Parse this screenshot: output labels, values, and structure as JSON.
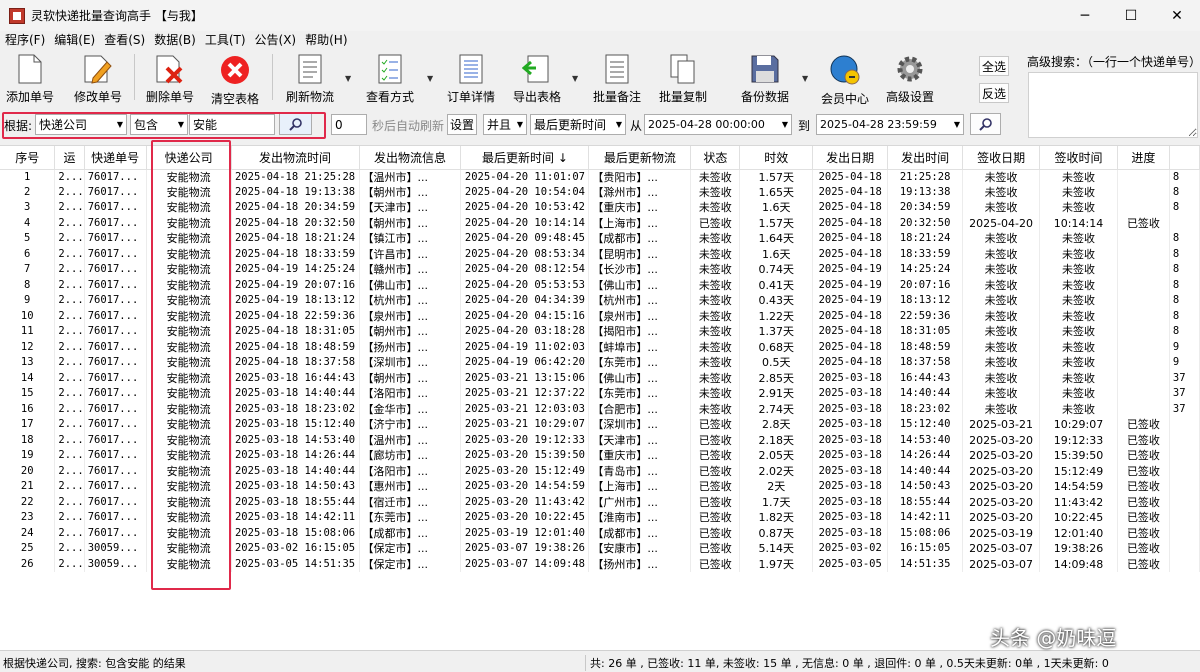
{
  "window": {
    "title": "灵软快递批量查询高手 【与我】",
    "min": "─",
    "max": "☐",
    "close": "✕"
  },
  "menu": [
    "程序(F)",
    "编辑(E)",
    "查看(S)",
    "数据(B)",
    "工具(T)",
    "公告(X)",
    "帮助(H)"
  ],
  "toolbar": {
    "add": "添加单号",
    "edit": "修改单号",
    "delete": "删除单号",
    "clear": "清空表格",
    "refresh": "刷新物流",
    "view": "查看方式",
    "detail": "订单详情",
    "export": "导出表格",
    "note": "批量备注",
    "copy": "批量复制",
    "backup": "备份数据",
    "vip": "会员中心",
    "settings": "高级设置",
    "select_all": "全选",
    "invert": "反选",
    "advanced_search_label": "高级搜索：（一行一个快递单号）"
  },
  "filter": {
    "by_label": "根据:",
    "by_value": "快递公司",
    "op_value": "包含",
    "keyword": "安能",
    "seconds": "0",
    "auto_refresh": "秒后自动刷新",
    "set_btn": "设置",
    "logic": "并且",
    "time_field": "最后更新时间",
    "from_label": "从",
    "from": "2025-04-28 00:00:00",
    "to_label": "到",
    "to": "2025-04-28 23:59:59"
  },
  "columns": [
    "序号",
    "运",
    "快递单号",
    "快递公司",
    "发出物流时间",
    "发出物流信息",
    "最后更新时间 ↓",
    "最后更新物流",
    "状态",
    "时效",
    "发出日期",
    "发出时间",
    "签收日期",
    "签收时间",
    "进度",
    ""
  ],
  "rows": [
    [
      "1",
      "2...",
      "76017...",
      "安能物流",
      "2025-04-18 21:25:28",
      "【温州市】...",
      "2025-04-20 11:01:07",
      "【贵阳市】...",
      "未签收",
      "1.57天",
      "2025-04-18",
      "21:25:28",
      "未签收",
      "未签收",
      "",
      "8"
    ],
    [
      "2",
      "2...",
      "76017...",
      "安能物流",
      "2025-04-18 19:13:38",
      "【朝州市】...",
      "2025-04-20 10:54:04",
      "【滁州市】...",
      "未签收",
      "1.65天",
      "2025-04-18",
      "19:13:38",
      "未签收",
      "未签收",
      "",
      "8"
    ],
    [
      "3",
      "2...",
      "76017...",
      "安能物流",
      "2025-04-18 20:34:59",
      "【天津市】...",
      "2025-04-20 10:53:42",
      "【重庆市】...",
      "未签收",
      "1.6天",
      "2025-04-18",
      "20:34:59",
      "未签收",
      "未签收",
      "",
      "8"
    ],
    [
      "4",
      "2...",
      "76017...",
      "安能物流",
      "2025-04-18 20:32:50",
      "【朝州市】...",
      "2025-04-20 10:14:14",
      "【上海市】...",
      "已签收",
      "1.57天",
      "2025-04-18",
      "20:32:50",
      "2025-04-20",
      "10:14:14",
      "已签收",
      ""
    ],
    [
      "5",
      "2...",
      "76017...",
      "安能物流",
      "2025-04-18 18:21:24",
      "【镇江市】...",
      "2025-04-20 09:48:45",
      "【成都市】...",
      "未签收",
      "1.64天",
      "2025-04-18",
      "18:21:24",
      "未签收",
      "未签收",
      "",
      "8"
    ],
    [
      "6",
      "2...",
      "76017...",
      "安能物流",
      "2025-04-18 18:33:59",
      "【许昌市】...",
      "2025-04-20 08:53:34",
      "【昆明市】...",
      "未签收",
      "1.6天",
      "2025-04-18",
      "18:33:59",
      "未签收",
      "未签收",
      "",
      "8"
    ],
    [
      "7",
      "2...",
      "76017...",
      "安能物流",
      "2025-04-19 14:25:24",
      "【赣州市】...",
      "2025-04-20 08:12:54",
      "【长沙市】...",
      "未签收",
      "0.74天",
      "2025-04-19",
      "14:25:24",
      "未签收",
      "未签收",
      "",
      "8"
    ],
    [
      "8",
      "2...",
      "76017...",
      "安能物流",
      "2025-04-19 20:07:16",
      "【佛山市】...",
      "2025-04-20 05:53:53",
      "【佛山市】...",
      "未签收",
      "0.41天",
      "2025-04-19",
      "20:07:16",
      "未签收",
      "未签收",
      "",
      "8"
    ],
    [
      "9",
      "2...",
      "76017...",
      "安能物流",
      "2025-04-19 18:13:12",
      "【杭州市】...",
      "2025-04-20 04:34:39",
      "【杭州市】...",
      "未签收",
      "0.43天",
      "2025-04-19",
      "18:13:12",
      "未签收",
      "未签收",
      "",
      "8"
    ],
    [
      "10",
      "2...",
      "76017...",
      "安能物流",
      "2025-04-18 22:59:36",
      "【泉州市】...",
      "2025-04-20 04:15:16",
      "【泉州市】...",
      "未签收",
      "1.22天",
      "2025-04-18",
      "22:59:36",
      "未签收",
      "未签收",
      "",
      "8"
    ],
    [
      "11",
      "2...",
      "76017...",
      "安能物流",
      "2025-04-18 18:31:05",
      "【朝州市】...",
      "2025-04-20 03:18:28",
      "【揭阳市】...",
      "未签收",
      "1.37天",
      "2025-04-18",
      "18:31:05",
      "未签收",
      "未签收",
      "",
      "8"
    ],
    [
      "12",
      "2...",
      "76017...",
      "安能物流",
      "2025-04-18 18:48:59",
      "【扬州市】...",
      "2025-04-19 11:02:03",
      "【蚌埠市】...",
      "未签收",
      "0.68天",
      "2025-04-18",
      "18:48:59",
      "未签收",
      "未签收",
      "",
      "9"
    ],
    [
      "13",
      "2...",
      "76017...",
      "安能物流",
      "2025-04-18 18:37:58",
      "【深圳市】...",
      "2025-04-19 06:42:20",
      "【东莞市】...",
      "未签收",
      "0.5天",
      "2025-04-18",
      "18:37:58",
      "未签收",
      "未签收",
      "",
      "9"
    ],
    [
      "14",
      "2...",
      "76017...",
      "安能物流",
      "2025-03-18 16:44:43",
      "【朝州市】...",
      "2025-03-21 13:15:06",
      "【佛山市】...",
      "未签收",
      "2.85天",
      "2025-03-18",
      "16:44:43",
      "未签收",
      "未签收",
      "",
      "37"
    ],
    [
      "15",
      "2...",
      "76017...",
      "安能物流",
      "2025-03-18 14:40:44",
      "【洛阳市】...",
      "2025-03-21 12:37:22",
      "【东莞市】...",
      "未签收",
      "2.91天",
      "2025-03-18",
      "14:40:44",
      "未签收",
      "未签收",
      "",
      "37"
    ],
    [
      "16",
      "2...",
      "76017...",
      "安能物流",
      "2025-03-18 18:23:02",
      "【金华市】...",
      "2025-03-21 12:03:03",
      "【合肥市】...",
      "未签收",
      "2.74天",
      "2025-03-18",
      "18:23:02",
      "未签收",
      "未签收",
      "",
      "37"
    ],
    [
      "17",
      "2...",
      "76017...",
      "安能物流",
      "2025-03-18 15:12:40",
      "【济宁市】...",
      "2025-03-21 10:29:07",
      "【深圳市】...",
      "已签收",
      "2.8天",
      "2025-03-18",
      "15:12:40",
      "2025-03-21",
      "10:29:07",
      "已签收",
      ""
    ],
    [
      "18",
      "2...",
      "76017...",
      "安能物流",
      "2025-03-18 14:53:40",
      "【温州市】...",
      "2025-03-20 19:12:33",
      "【天津市】...",
      "已签收",
      "2.18天",
      "2025-03-18",
      "14:53:40",
      "2025-03-20",
      "19:12:33",
      "已签收",
      ""
    ],
    [
      "19",
      "2...",
      "76017...",
      "安能物流",
      "2025-03-18 14:26:44",
      "【廊坊市】...",
      "2025-03-20 15:39:50",
      "【重庆市】...",
      "已签收",
      "2.05天",
      "2025-03-18",
      "14:26:44",
      "2025-03-20",
      "15:39:50",
      "已签收",
      ""
    ],
    [
      "20",
      "2...",
      "76017...",
      "安能物流",
      "2025-03-18 14:40:44",
      "【洛阳市】...",
      "2025-03-20 15:12:49",
      "【青岛市】...",
      "已签收",
      "2.02天",
      "2025-03-18",
      "14:40:44",
      "2025-03-20",
      "15:12:49",
      "已签收",
      ""
    ],
    [
      "21",
      "2...",
      "76017...",
      "安能物流",
      "2025-03-18 14:50:43",
      "【惠州市】...",
      "2025-03-20 14:54:59",
      "【上海市】...",
      "已签收",
      "2天",
      "2025-03-18",
      "14:50:43",
      "2025-03-20",
      "14:54:59",
      "已签收",
      ""
    ],
    [
      "22",
      "2...",
      "76017...",
      "安能物流",
      "2025-03-18 18:55:44",
      "【宿迁市】...",
      "2025-03-20 11:43:42",
      "【广州市】...",
      "已签收",
      "1.7天",
      "2025-03-18",
      "18:55:44",
      "2025-03-20",
      "11:43:42",
      "已签收",
      ""
    ],
    [
      "23",
      "2...",
      "76017...",
      "安能物流",
      "2025-03-18 14:42:11",
      "【东莞市】...",
      "2025-03-20 10:22:45",
      "【淮南市】...",
      "已签收",
      "1.82天",
      "2025-03-18",
      "14:42:11",
      "2025-03-20",
      "10:22:45",
      "已签收",
      ""
    ],
    [
      "24",
      "2...",
      "76017...",
      "安能物流",
      "2025-03-18 15:08:06",
      "【成都市】...",
      "2025-03-19 12:01:40",
      "【成都市】...",
      "已签收",
      "0.87天",
      "2025-03-18",
      "15:08:06",
      "2025-03-19",
      "12:01:40",
      "已签收",
      ""
    ],
    [
      "25",
      "2...",
      "30059...",
      "安能物流",
      "2025-03-02 16:15:05",
      "【保定市】...",
      "2025-03-07 19:38:26",
      "【安康市】...",
      "已签收",
      "5.14天",
      "2025-03-02",
      "16:15:05",
      "2025-03-07",
      "19:38:26",
      "已签收",
      ""
    ],
    [
      "26",
      "2...",
      "30059...",
      "安能物流",
      "2025-03-05 14:51:35",
      "【保定市】...",
      "2025-03-07 14:09:48",
      "【扬州市】...",
      "已签收",
      "1.97天",
      "2025-03-05",
      "14:51:35",
      "2025-03-07",
      "14:09:48",
      "已签收",
      ""
    ]
  ],
  "status": {
    "left": "根据快递公司, 搜索: 包含安能 的结果",
    "right": "共: 26 单 , 已签收: 11 单, 未签收: 15 单 , 无信息: 0 单 , 退回件: 0 单 , 0.5天未更新: 0单 , 1天未更新: 0"
  },
  "watermark": "头条 @奶味逗"
}
